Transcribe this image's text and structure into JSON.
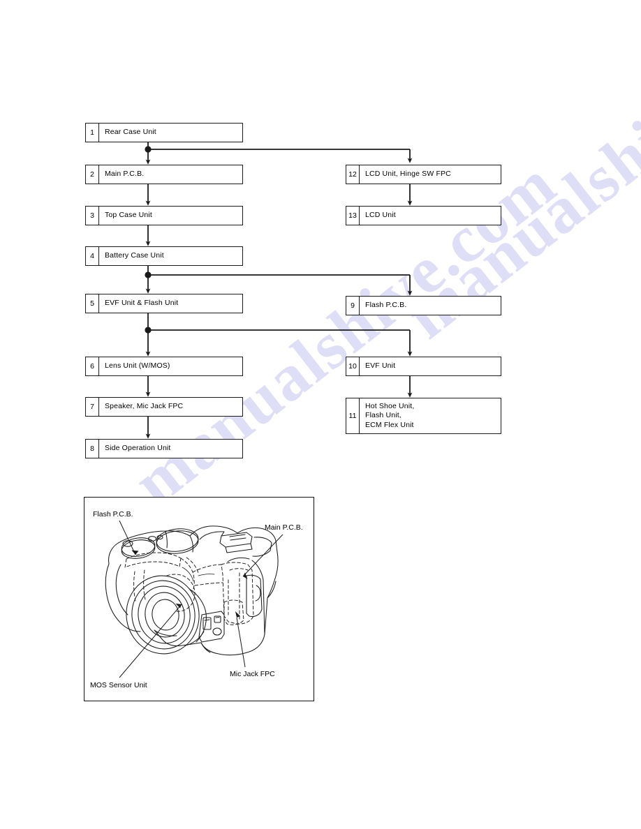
{
  "flowchart": {
    "left_column": [
      {
        "num": "1",
        "label": "Rear Case Unit"
      },
      {
        "num": "2",
        "label": "Main P.C.B."
      },
      {
        "num": "3",
        "label": "Top Case Unit"
      },
      {
        "num": "4",
        "label": "Battery Case Unit"
      },
      {
        "num": "5",
        "label": "EVF Unit & Flash Unit"
      },
      {
        "num": "6",
        "label": "Lens Unit (W/MOS)"
      },
      {
        "num": "7",
        "label": "Speaker, Mic Jack FPC"
      },
      {
        "num": "8",
        "label": "Side Operation Unit"
      }
    ],
    "right_column": [
      {
        "num": "12",
        "label": "LCD Unit, Hinge SW FPC"
      },
      {
        "num": "13",
        "label": "LCD Unit"
      },
      {
        "num": "9",
        "label": "Flash P.C.B."
      },
      {
        "num": "10",
        "label": "EVF Unit"
      },
      {
        "num": "11",
        "label": "Hot Shoe Unit,\nFlash Unit,\nECM Flex Unit"
      }
    ]
  },
  "figure": {
    "callouts": [
      {
        "id": "flash-pcb",
        "label": "Flash P.C.B."
      },
      {
        "id": "main-pcb",
        "label": "Main P.C.B."
      },
      {
        "id": "mic-jack-fpc",
        "label": "Mic Jack FPC"
      },
      {
        "id": "mos-sensor-unit",
        "label": "MOS Sensor Unit"
      }
    ]
  },
  "watermark": {
    "line_a": "manualshive.com",
    "line_b": "manualshive.com"
  },
  "colors": {
    "ink": "#1a1a1a",
    "paper": "#ffffff",
    "watermark": "#b9b8ee"
  }
}
